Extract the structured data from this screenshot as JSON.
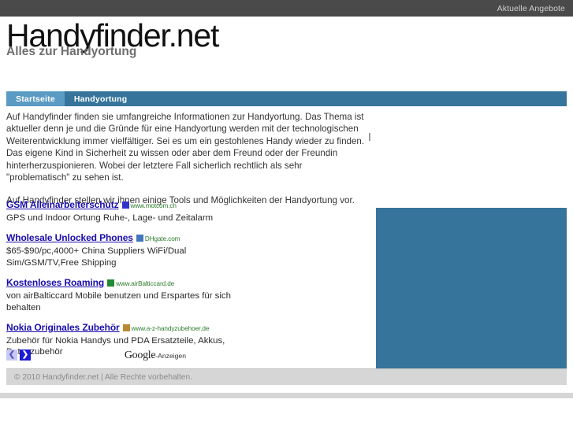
{
  "topbar": {
    "link_label": "Aktuelle Angebote",
    "background": "#4a4a4a",
    "text_color": "#cfcfcf"
  },
  "masthead": {
    "logo": "Handyfinder.net",
    "tagline": "Alles zur Handyortung"
  },
  "nav": {
    "background": "#36749b",
    "active_background": "#5a9bc4",
    "items": [
      {
        "label": "Startseite",
        "active": true
      },
      {
        "label": "Handyortung",
        "active": false
      }
    ]
  },
  "main": {
    "paragraphs": [
      "Auf Handyfinder finden sie umfangreiche Informationen zur Handyortung. Das Thema ist aktueller denn je und die Gründe für eine Handyortung werden mit der technologischen Weiterentwicklung immer vielfältiger. Sei es um ein gestohlenes Handy wieder zu finden. Das eigene Kind in Sicherheit zu wissen oder aber dem Freund oder der Freundin hinterherzuspionieren. Wobei der letztere Fall sicherlich rechtlich als sehr \"problematisch\" zu sehen ist.",
      "Auf Handyfinder stellen wir ihnen einige Tools und Möglichkeiten der Handyortung vor."
    ]
  },
  "ads": {
    "items": [
      {
        "title": "GSM Alleinarbeiterschutz",
        "url": "www.motcom.ch",
        "favicon_color": "#3333cc",
        "description": "GPS und Indoor Ortung Ruhe-, Lage- und Zeitalarm"
      },
      {
        "title": "Wholesale Unlocked Phones",
        "url": "DHgate.com",
        "favicon_color": "#4477bb",
        "description": "$65-$90/pc,4000+ China Suppliers WiFi/Dual Sim/GSM/TV,Free Shipping"
      },
      {
        "title": "Kostenloses Roaming",
        "url": "www.airBalticcard.de",
        "favicon_color": "#228833",
        "description": "von airBalticcard Mobile benutzen und Erspartes für sich behalten"
      },
      {
        "title": "Nokia Originales Zubehör",
        "url": "www.a-z-handyzubehoer.de",
        "favicon_color": "#bb8833",
        "description": "Zubehör für Nokia Handys und PDA Ersatzteile, Akkus, Datenzubehör"
      }
    ],
    "prev_arrow": "❮",
    "next_arrow": "❯",
    "google_word": "Google",
    "google_suffix": "-Anzeigen"
  },
  "sidepanel": {
    "background": "#36749b"
  },
  "footer": {
    "text": "© 2010 Handyfinder.net | Alle Rechte vorbehalten.",
    "background": "#d6d6d6"
  }
}
